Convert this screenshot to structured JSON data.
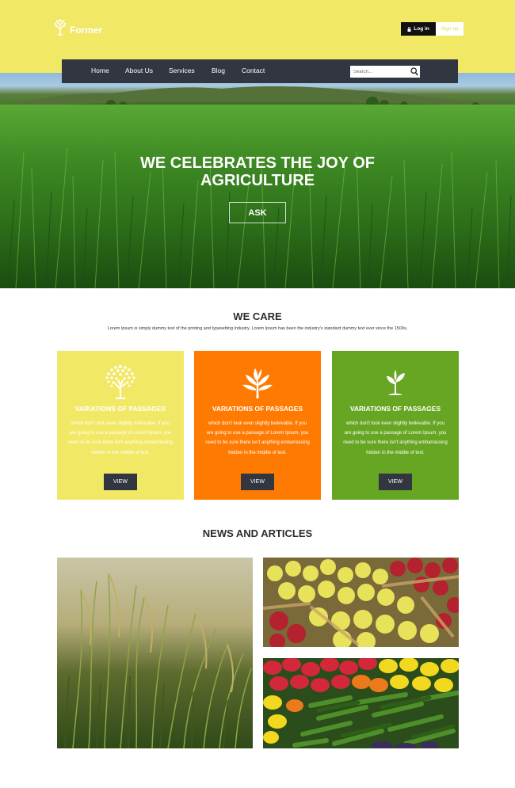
{
  "brand": {
    "name": "Former"
  },
  "auth": {
    "login_label": "Log in",
    "signup_label": "Sign up"
  },
  "nav": {
    "items": [
      {
        "label": "Home"
      },
      {
        "label": "About Us"
      },
      {
        "label": "Services"
      },
      {
        "label": "Blog"
      },
      {
        "label": "Contact"
      }
    ],
    "search_placeholder": "Search..."
  },
  "hero": {
    "title_line1": "WE CELEBRATES THE JOY OF",
    "title_line2": "AGRICULTURE",
    "button_label": "ASK"
  },
  "care": {
    "title": "WE CARE",
    "description": "Lorem Ipsum is simply dummy text of the printing and typesetting industry. Lorem Ipsum has been the industry's standard dummy text ever since the 1500s,",
    "cards": [
      {
        "title": "VARIATIONS OF PASSAGES",
        "text": "which don't look even slightly believable. If you are going to use a passage of Lorem Ipsum, you need to be sure there isn't anything embarrassing hidden in the middle of text.",
        "button_label": "VIEW",
        "color": "#f1e866",
        "icon": "tree-icon"
      },
      {
        "title": "VARIATIONS OF PASSAGES",
        "text": "which don't look even slightly believable. If you are going to use a passage of Lorem Ipsum, you need to be sure there isn't anything embarrassing hidden in the middle of text.",
        "button_label": "VIEW",
        "color": "#ff7a00",
        "icon": "plant-icon"
      },
      {
        "title": "VARIATIONS OF PASSAGES",
        "text": "which don't look even slightly believable. If you are going to use a passage of Lorem Ipsum, you need to be sure there isn't anything embarrassing hidden in the middle of text.",
        "button_label": "VIEW",
        "color": "#67a623",
        "icon": "sprout-icon"
      }
    ]
  },
  "news": {
    "title": "NEWS AND ARTICLES"
  },
  "colors": {
    "header_bg": "#f1e866",
    "nav_bg": "#323640",
    "button_dark": "#323640"
  }
}
